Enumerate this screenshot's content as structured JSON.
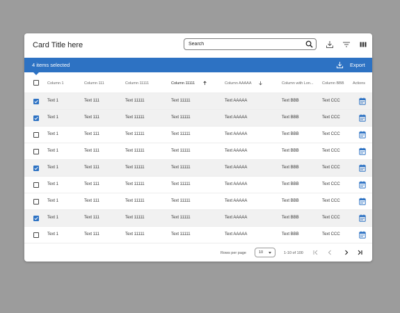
{
  "card": {
    "title": "Card Title here"
  },
  "search": {
    "placeholder": "Search",
    "value": ""
  },
  "header_icons": [
    "download-icon",
    "filter-icon",
    "columns-icon"
  ],
  "selection": {
    "text": "4 items selected",
    "export_label": "Export"
  },
  "columns": [
    {
      "label": "Column 1"
    },
    {
      "label": "Column 111"
    },
    {
      "label": "Column 11111"
    },
    {
      "label": "Column 11111",
      "sort": "ascending"
    },
    {
      "label": "Column AAAAA",
      "sort": "descending"
    },
    {
      "label": "Column with Lon..."
    },
    {
      "label": "Column BBB"
    },
    {
      "label": "Actions"
    }
  ],
  "rows": [
    {
      "selected": true,
      "cells": [
        "Text 1",
        "Text 111",
        "Text 11111",
        "Text 11111",
        "Text AAAAA",
        "Text BBB",
        "Text CCC"
      ]
    },
    {
      "selected": true,
      "cells": [
        "Text 1",
        "Text 111",
        "Text 11111",
        "Text 11111",
        "Text AAAAA",
        "Text BBB",
        "Text CCC"
      ]
    },
    {
      "selected": false,
      "cells": [
        "Text 1",
        "Text 111",
        "Text 11111",
        "Text 11111",
        "Text AAAAA",
        "Text BBB",
        "Text CCC"
      ]
    },
    {
      "selected": false,
      "cells": [
        "Text 1",
        "Text 111",
        "Text 11111",
        "Text 11111",
        "Text AAAAA",
        "Text BBB",
        "Text CCC"
      ]
    },
    {
      "selected": true,
      "cells": [
        "Text 1",
        "Text 111",
        "Text 11111",
        "Text 11111",
        "Text AAAAA",
        "Text BBB",
        "Text CCC"
      ]
    },
    {
      "selected": false,
      "cells": [
        "Text 1",
        "Text 111",
        "Text 11111",
        "Text 11111",
        "Text AAAAA",
        "Text BBB",
        "Text CCC"
      ]
    },
    {
      "selected": false,
      "cells": [
        "Text 1",
        "Text 111",
        "Text 11111",
        "Text 11111",
        "Text AAAAA",
        "Text BBB",
        "Text CCC"
      ]
    },
    {
      "selected": true,
      "cells": [
        "Text 1",
        "Text 111",
        "Text 11111",
        "Text 11111",
        "Text AAAAA",
        "Text BBB",
        "Text CCC"
      ]
    },
    {
      "selected": false,
      "cells": [
        "Text 1",
        "Text 111",
        "Text 11111",
        "Text 11111",
        "Text AAAAA",
        "Text BBB",
        "Text CCC"
      ]
    }
  ],
  "row_action_icon": "calendar-icon",
  "pagination": {
    "rows_per_page_label": "Rows per page",
    "rows_per_page": "10",
    "range": "1-10 of 100"
  },
  "colors": {
    "accent": "#2d72c3",
    "selected_row": "#f1f1f1",
    "background": "#9c9c9c"
  }
}
